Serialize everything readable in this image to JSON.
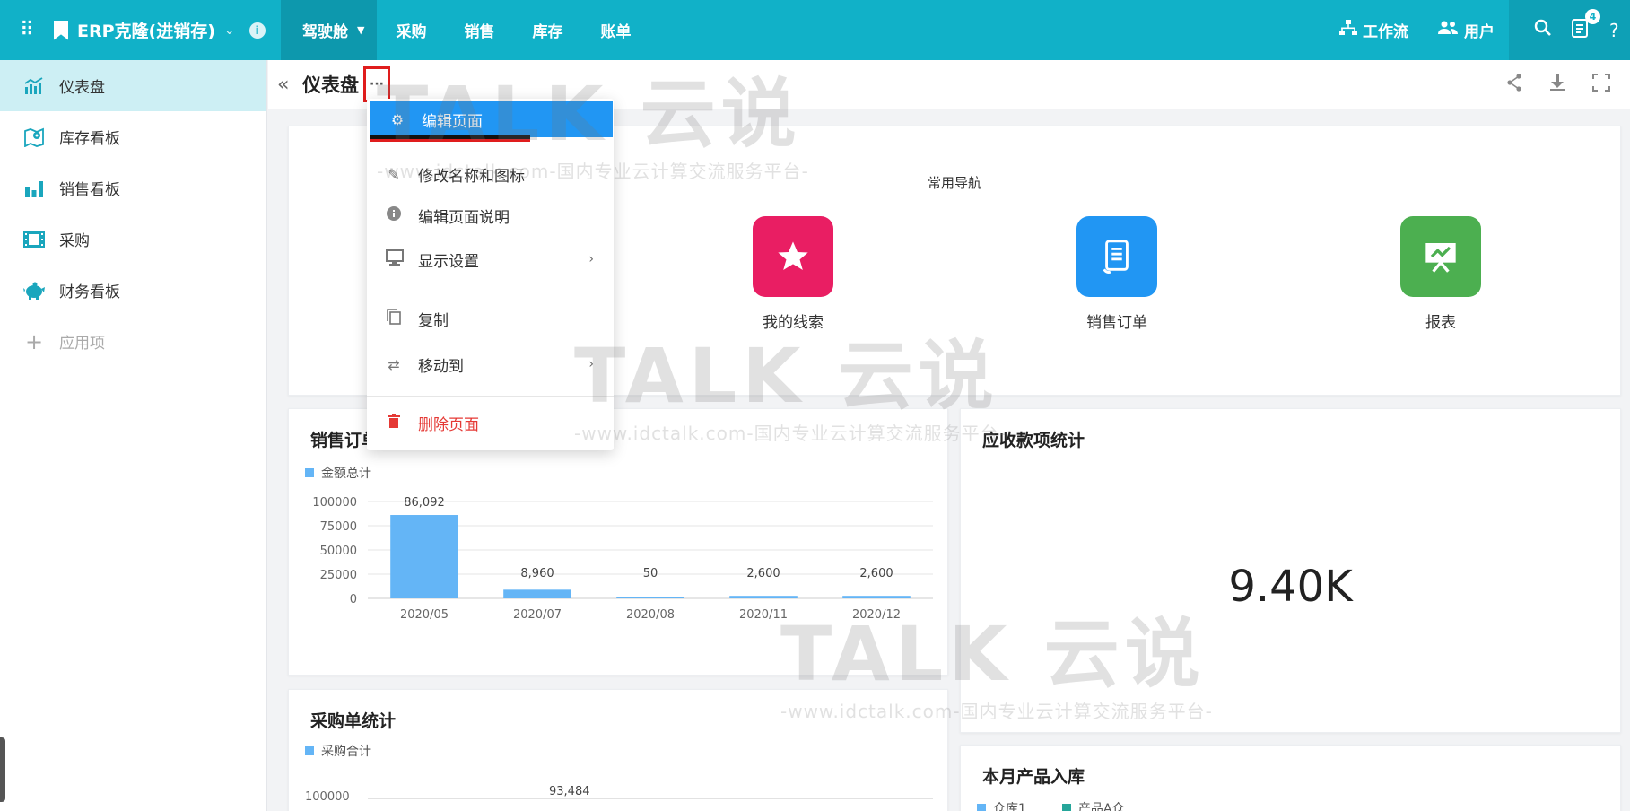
{
  "topbar": {
    "app_title": "ERP克隆(进销存)",
    "nav": [
      "驾驶舱",
      "采购",
      "销售",
      "库存",
      "账单"
    ],
    "workflow_label": "工作流",
    "users_label": "用户",
    "notification_count": "4"
  },
  "sidebar": {
    "items": [
      {
        "label": "仪表盘",
        "icon": "chart-bar-icon"
      },
      {
        "label": "库存看板",
        "icon": "map-pin-icon"
      },
      {
        "label": "销售看板",
        "icon": "bar-chart-icon"
      },
      {
        "label": "采购",
        "icon": "film-icon"
      },
      {
        "label": "财务看板",
        "icon": "piggy-bank-icon"
      }
    ],
    "add_label": "应用项"
  },
  "header": {
    "title": "仪表盘",
    "more_label": "···"
  },
  "menu": {
    "items": [
      "编辑页面",
      "修改名称和图标",
      "编辑页面说明",
      "显示设置",
      "复制",
      "移动到",
      "删除页面"
    ]
  },
  "quick_nav": {
    "heading": "常用导航",
    "items": [
      {
        "label": "我的线索",
        "color": "#e91e63",
        "icon": "star-icon"
      },
      {
        "label": "销售订单",
        "color": "#2196f3",
        "icon": "receipt-icon"
      },
      {
        "label": "报表",
        "color": "#4caf50",
        "icon": "presentation-icon"
      }
    ]
  },
  "sales_card": {
    "title": "销售订单",
    "legend": "金额总计"
  },
  "receivable_card": {
    "title": "应收款项统计",
    "value": "9.40K"
  },
  "purchase_card": {
    "title": "采购单统计",
    "legend": "采购合计",
    "y_top_label": "100000",
    "first_value_label": "93,484"
  },
  "stock_card": {
    "title": "本月产品入库",
    "legend": [
      "仓库1",
      "产品A仓"
    ]
  },
  "watermark": {
    "brand": "TALK 云说",
    "tagline": "-www.idctalk.com-国内专业云计算交流服务平台-"
  },
  "chart_data": [
    {
      "type": "bar",
      "categories": [
        "2020/05",
        "2020/07",
        "2020/08",
        "2020/11",
        "2020/12"
      ],
      "series": [
        {
          "name": "金额总计",
          "values": [
            86092,
            8960,
            50,
            2600,
            2600
          ]
        }
      ],
      "value_labels": [
        "86,092",
        "8,960",
        "50",
        "2,600",
        "2,600"
      ],
      "yticks": [
        0,
        25000,
        50000,
        75000,
        100000
      ],
      "ylim": [
        0,
        100000
      ],
      "color": "#64b5f6"
    }
  ]
}
